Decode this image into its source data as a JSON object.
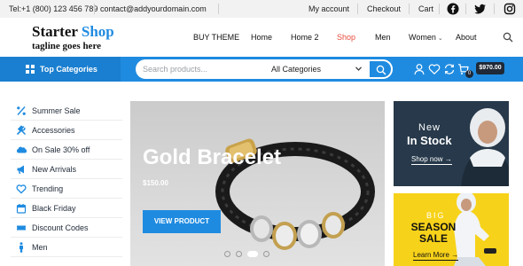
{
  "topbar": {
    "phone": "Tel:+1 (800) 123 456 789",
    "email": "contact@addyourdomain.com",
    "links": [
      "My account",
      "Checkout",
      "Cart"
    ],
    "social": [
      "facebook-icon",
      "twitter-icon",
      "instagram-icon"
    ]
  },
  "header": {
    "logo_word1": "Starter",
    "logo_word2": "Shop",
    "tagline": "tagline goes here",
    "nav": [
      {
        "label": "BUY THEME"
      },
      {
        "label": "Home"
      },
      {
        "label": "Home 2"
      },
      {
        "label": "Shop",
        "active": true
      },
      {
        "label": "Men"
      },
      {
        "label": "Women"
      },
      {
        "label": "About"
      }
    ]
  },
  "bluebar": {
    "categories_label": "Top Categories",
    "search_placeholder": "Search products...",
    "category_select": "All Categories",
    "cart_count": "0",
    "cart_total": "$970.00"
  },
  "sidebar": {
    "items": [
      {
        "label": "Summer Sale",
        "icon": "percent-icon"
      },
      {
        "label": "Accessories",
        "icon": "tools-icon"
      },
      {
        "label": "On Sale 30% off",
        "icon": "salesforce-cloud-icon"
      },
      {
        "label": "New Arrivals",
        "icon": "megaphone-icon"
      },
      {
        "label": "Trending",
        "icon": "heart-icon"
      },
      {
        "label": "Black Friday",
        "icon": "calendar-icon"
      },
      {
        "label": "Discount Codes",
        "icon": "ticket-icon"
      },
      {
        "label": "Men",
        "icon": "male-icon"
      }
    ]
  },
  "hero": {
    "title": "Gold Bracelet",
    "price": "$150.00",
    "button": "VIEW PRODUCT",
    "slides": 4,
    "active_slide": 3
  },
  "promo1": {
    "line1": "New",
    "line2": "In Stock",
    "link": "Shop now"
  },
  "promo2": {
    "line1": "BIG",
    "line2": "SEASON SALE",
    "link": "Learn More"
  },
  "colors": {
    "accent": "#1f8be0",
    "active_nav": "#e84c3d",
    "promo_dark": "#27394a",
    "promo_yellow": "#f7d21a"
  }
}
